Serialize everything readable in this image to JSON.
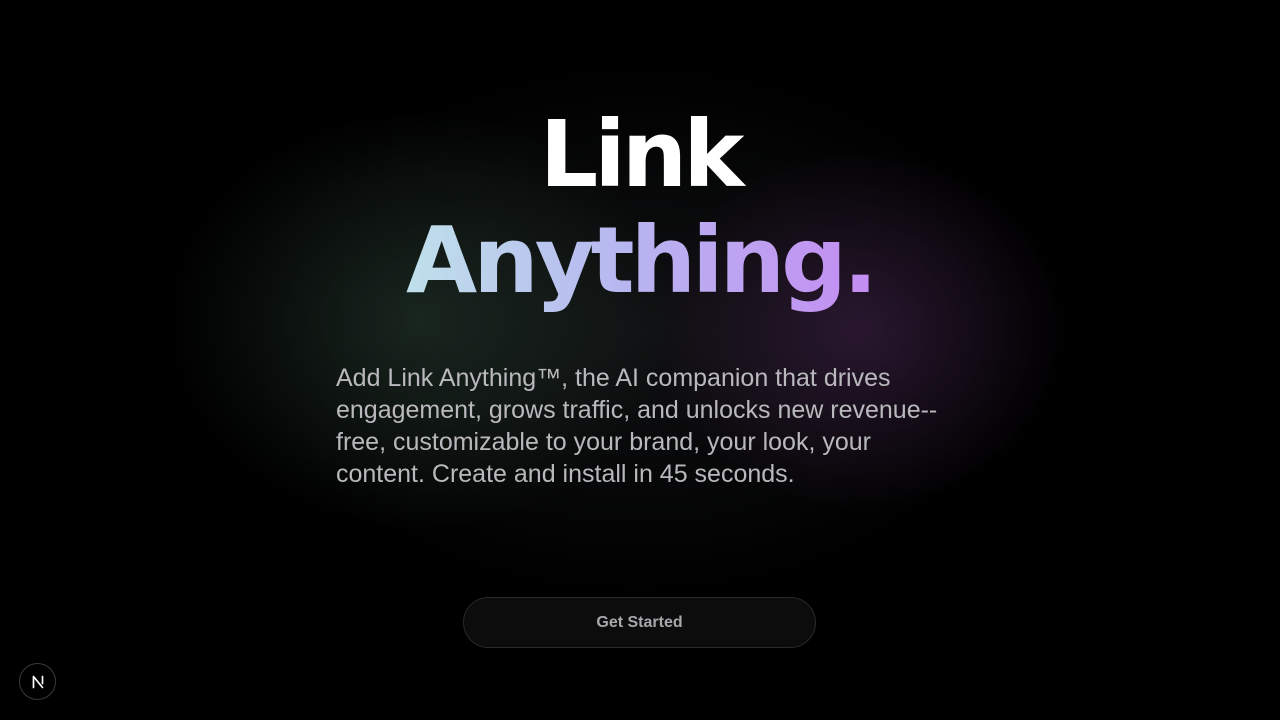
{
  "hero": {
    "title_line_1": "Link",
    "title_line_2": "Anything.",
    "description": "Add Link Anything™, the AI companion that drives engagement, grows traffic, and unlocks new revenue-- free, customizable to your brand, your look, your content. Create and install in 45 seconds.",
    "cta_label": "Get Started"
  },
  "badge": {
    "icon": "next-logo-icon"
  },
  "colors": {
    "background": "#000000",
    "title": "#ffffff",
    "gradient_start": "#bfe0ea",
    "gradient_end": "#c48cf2",
    "description": "#b9b9bd",
    "button_text": "#a8a8ac"
  }
}
